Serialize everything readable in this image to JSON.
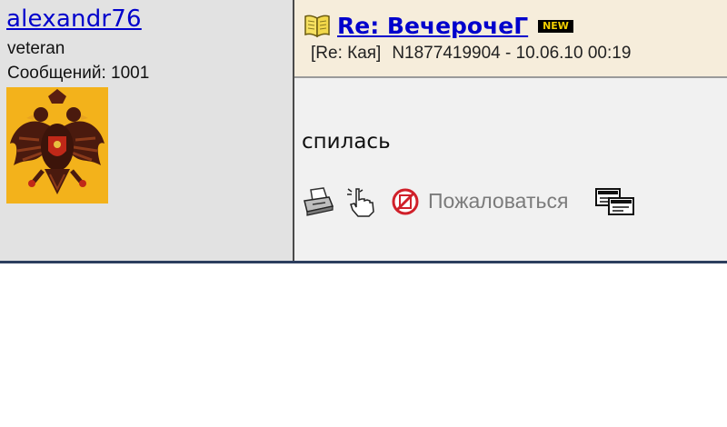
{
  "user": {
    "name": "alexandr76",
    "rank": "veteran",
    "posts_label": "Сообщений: 1001",
    "avatar_icon": "double-headed-eagle-icon"
  },
  "post": {
    "title": "Re: ВечерочеГ",
    "new_badge": "NEW",
    "reply_to": "[Re: Кая]",
    "meta": "N1877419904 - 10.06.10 00:19",
    "body": "спилась"
  },
  "actions": {
    "print_icon": "printer-icon",
    "hand_icon": "pointing-hand-icon",
    "report_icon": "report-icon",
    "report_label": "Пожаловаться",
    "quote_icon": "quote-reply-icon"
  },
  "colors": {
    "link": "#0000cc",
    "header_bg": "#f6eddb",
    "left_bg": "#e2e2e2",
    "body_bg": "#f1f1f1",
    "rule": "#2c3e5e"
  }
}
